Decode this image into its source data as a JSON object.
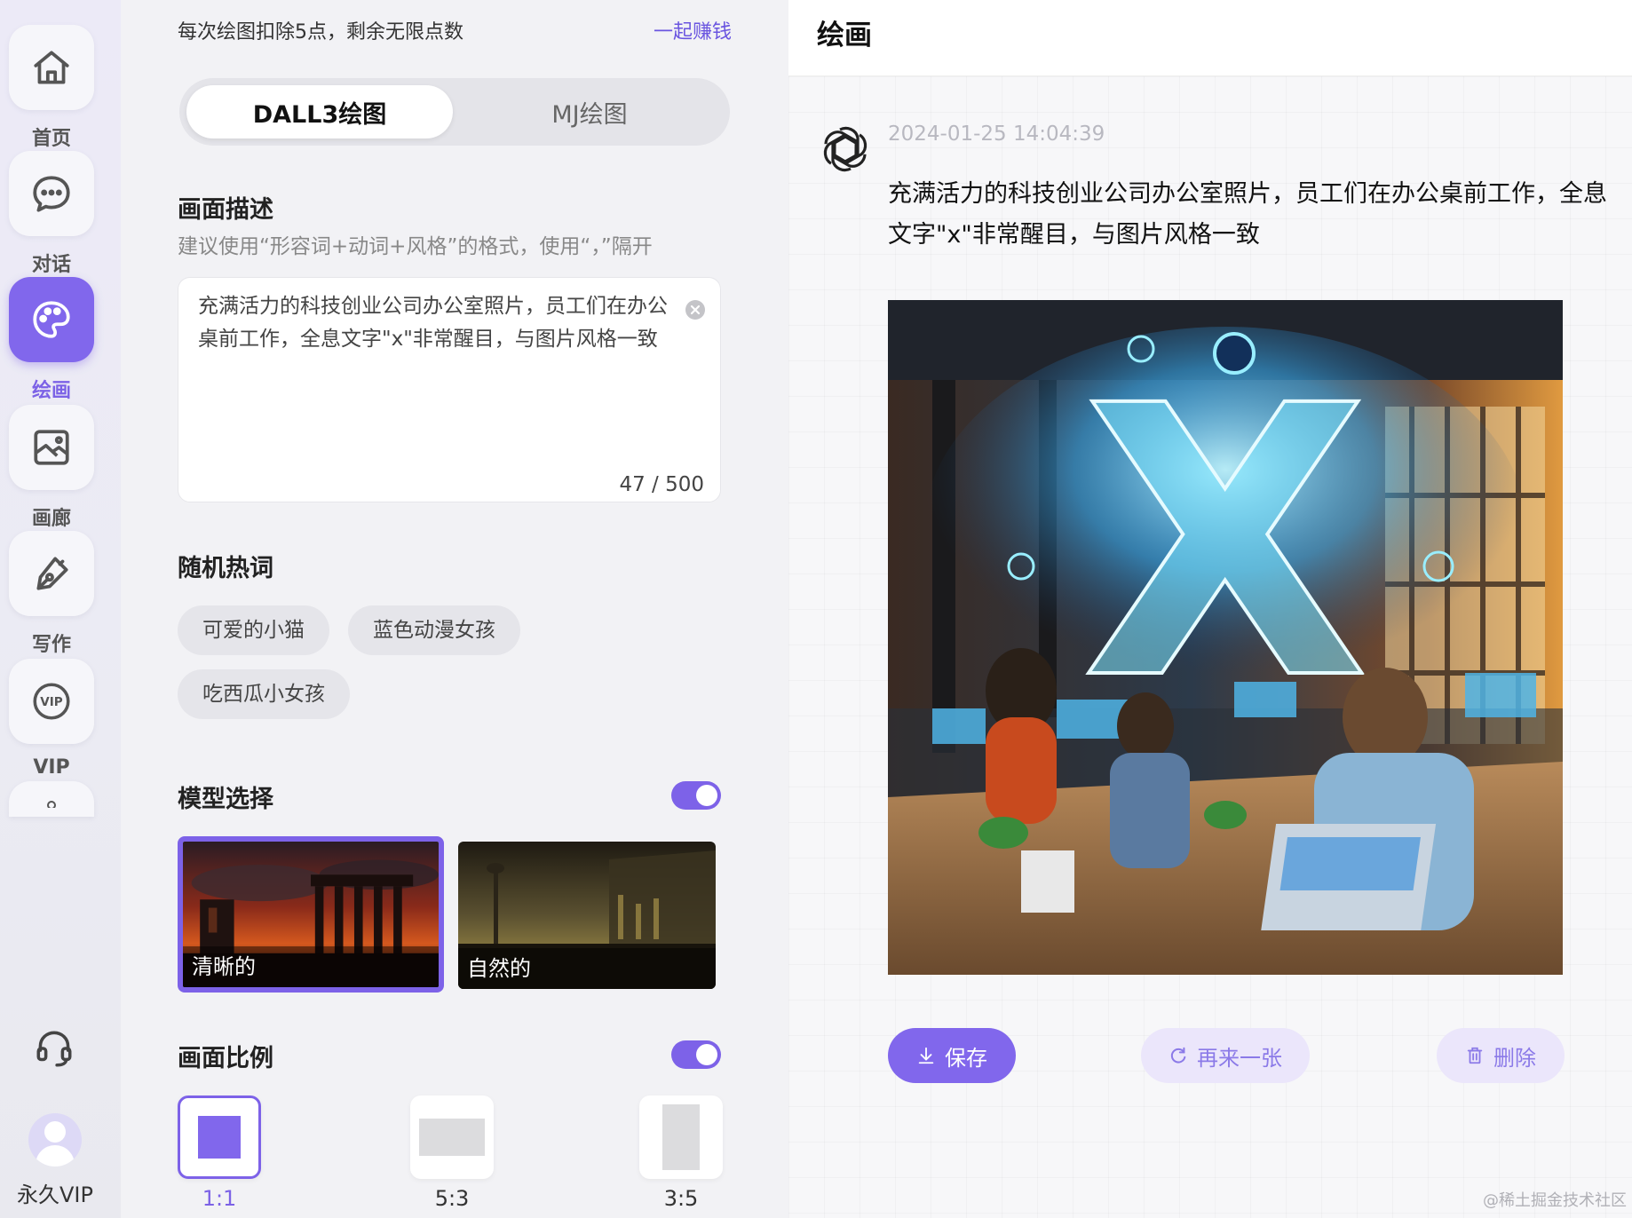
{
  "sidebar": {
    "items": [
      {
        "label": "首页",
        "icon": "home-icon"
      },
      {
        "label": "对话",
        "icon": "chat-icon"
      },
      {
        "label": "绘画",
        "icon": "palette-icon",
        "active": true
      },
      {
        "label": "画廊",
        "icon": "gallery-icon"
      },
      {
        "label": "写作",
        "icon": "pen-icon"
      },
      {
        "label": "VIP",
        "icon": "vip-icon"
      }
    ],
    "support_icon": "headset-icon",
    "user_label": "永久VIP"
  },
  "panel": {
    "notice": "每次绘图扣除5点，剩余无限点数",
    "earn_link": "一起赚钱",
    "modes": [
      "DALL3绘图",
      "MJ绘图"
    ],
    "description": {
      "title": "画面描述",
      "hint": "建议使用“形容词+动词+风格”的格式，使用“，”隔开",
      "value": "充满活力的科技创业公司办公室照片，员工们在办公桌前工作，全息文字\"x\"非常醒目，与图片风格一致",
      "counter": "47 / 500"
    },
    "hot_words": {
      "title": "随机热词",
      "chips": [
        "可爱的小猫",
        "蓝色动漫女孩",
        "吃西瓜小女孩"
      ]
    },
    "model": {
      "title": "模型选择",
      "enabled": true,
      "options": [
        {
          "label": "清晰的",
          "selected": true
        },
        {
          "label": "自然的",
          "selected": false
        }
      ]
    },
    "ratio": {
      "title": "画面比例",
      "enabled": true,
      "options": [
        {
          "label": "1:1",
          "selected": true
        },
        {
          "label": "5:3",
          "selected": false
        },
        {
          "label": "3:5",
          "selected": false
        }
      ]
    }
  },
  "result": {
    "title": "绘画",
    "timestamp": "2024-01-25 14:04:39",
    "prompt": "充满活力的科技创业公司办公室照片，员工们在办公桌前工作，全息文字\"x\"非常醒目，与图片风格一致",
    "image_text": "X",
    "actions": {
      "save": "保存",
      "regenerate": "再来一张",
      "delete": "删除"
    }
  },
  "watermark": "@稀土掘金技术社区",
  "colors": {
    "accent": "#8167ec",
    "accent_soft": "#ebe6fb"
  }
}
